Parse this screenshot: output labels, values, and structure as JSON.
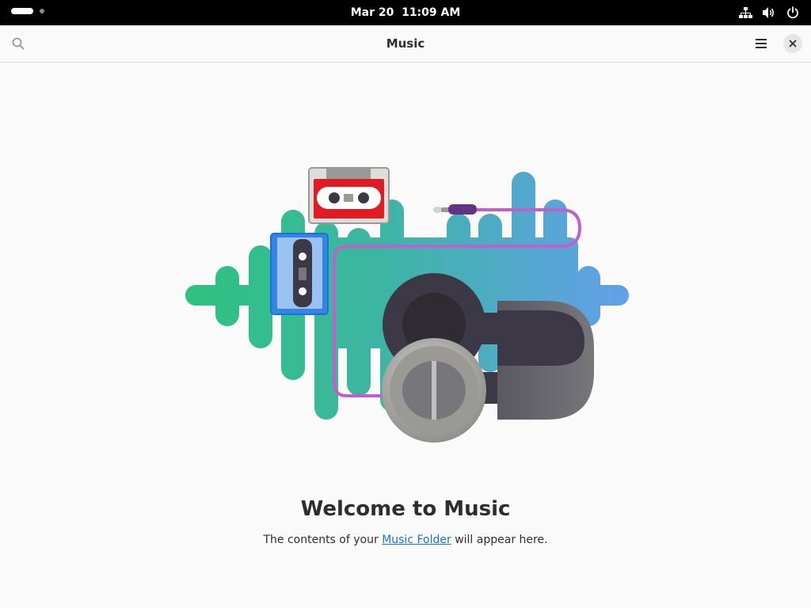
{
  "topbar": {
    "date": "Mar 20",
    "time": "11:09 AM",
    "tray_icons": [
      "network-icon",
      "volume-icon",
      "power-icon"
    ]
  },
  "header": {
    "title": "Music",
    "search_icon": "search-icon",
    "menu_icon": "hamburger-menu-icon",
    "close_icon": "close-icon"
  },
  "empty_state": {
    "heading": "Welcome to Music",
    "text_before": "The contents of your ",
    "link_label": "Music Folder",
    "text_after": " will appear here."
  },
  "colors": {
    "link": "#1c71d8",
    "wave_start": "#2ec27e",
    "wave_end": "#62a0ea",
    "cable": "#c061cb"
  }
}
